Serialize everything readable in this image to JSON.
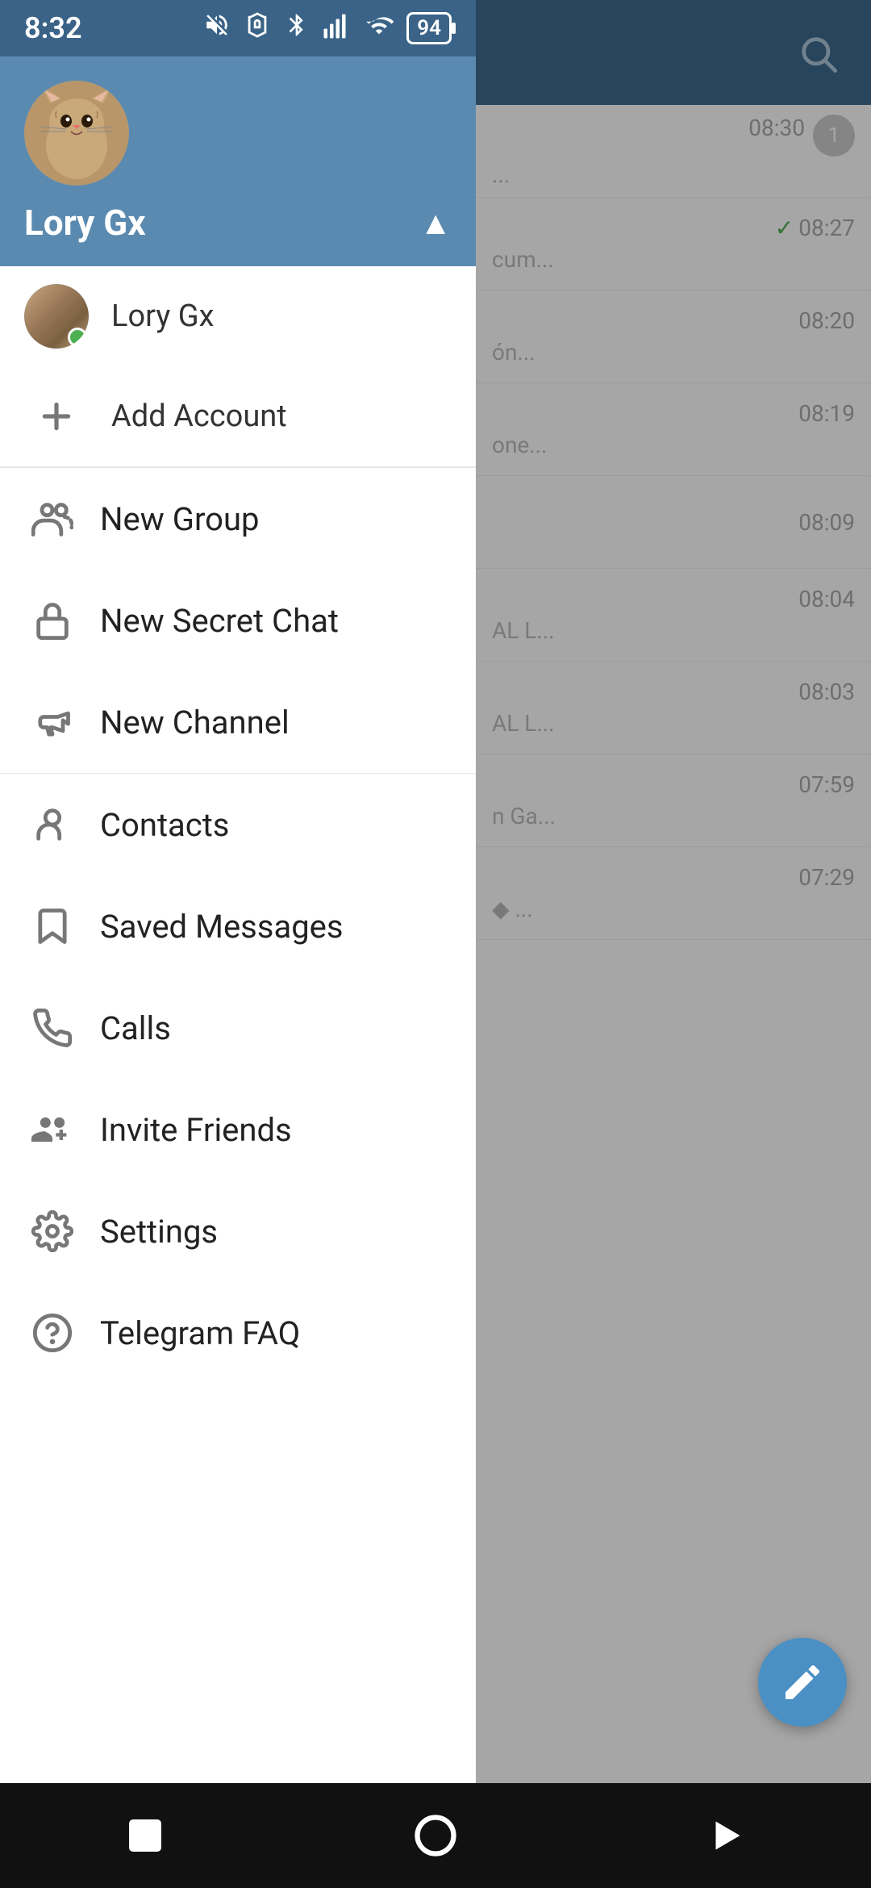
{
  "statusBar": {
    "time": "8:32",
    "battery": "94",
    "icons": [
      "mute-icon",
      "alarm-icon",
      "bluetooth-icon",
      "signal-icon",
      "wifi-icon"
    ]
  },
  "header": {
    "username": "Lory Gx",
    "chevron": "▲"
  },
  "accounts": [
    {
      "name": "Lory Gx",
      "online": true
    }
  ],
  "addAccount": {
    "label": "Add Account"
  },
  "menuGroups": [
    {
      "items": [
        {
          "id": "new-group",
          "label": "New Group",
          "icon": "group-icon"
        },
        {
          "id": "new-secret-chat",
          "label": "New Secret Chat",
          "icon": "lock-icon"
        },
        {
          "id": "new-channel",
          "label": "New Channel",
          "icon": "megaphone-icon"
        }
      ]
    },
    {
      "items": [
        {
          "id": "contacts",
          "label": "Contacts",
          "icon": "person-icon"
        },
        {
          "id": "saved-messages",
          "label": "Saved Messages",
          "icon": "bookmark-icon"
        },
        {
          "id": "calls",
          "label": "Calls",
          "icon": "phone-icon"
        },
        {
          "id": "invite-friends",
          "label": "Invite Friends",
          "icon": "person-add-icon"
        },
        {
          "id": "settings",
          "label": "Settings",
          "icon": "gear-icon"
        },
        {
          "id": "telegram-faq",
          "label": "Telegram FAQ",
          "icon": "help-icon"
        }
      ]
    }
  ],
  "bgChat": {
    "items": [
      {
        "time": "08:30",
        "msg": "...",
        "badge": "1"
      },
      {
        "time": "08:27",
        "msg": "cum...",
        "check": true
      },
      {
        "time": "08:20",
        "msg": "ón..."
      },
      {
        "time": "08:19",
        "msg": "one..."
      },
      {
        "time": "08:09",
        "msg": ""
      },
      {
        "time": "08:04",
        "msg": "AL L..."
      },
      {
        "time": "08:03",
        "msg": "AL L..."
      },
      {
        "time": "07:59",
        "msg": "n Ga..."
      },
      {
        "time": "07:29",
        "msg": "◆ ..."
      }
    ]
  },
  "fab": {
    "label": "compose",
    "icon": "pencil-icon"
  },
  "bottomNav": {
    "buttons": [
      {
        "id": "square-btn",
        "label": "stop",
        "icon": "square-icon"
      },
      {
        "id": "home-btn",
        "label": "home",
        "icon": "circle-icon"
      },
      {
        "id": "back-btn",
        "label": "back",
        "icon": "triangle-icon"
      }
    ]
  }
}
